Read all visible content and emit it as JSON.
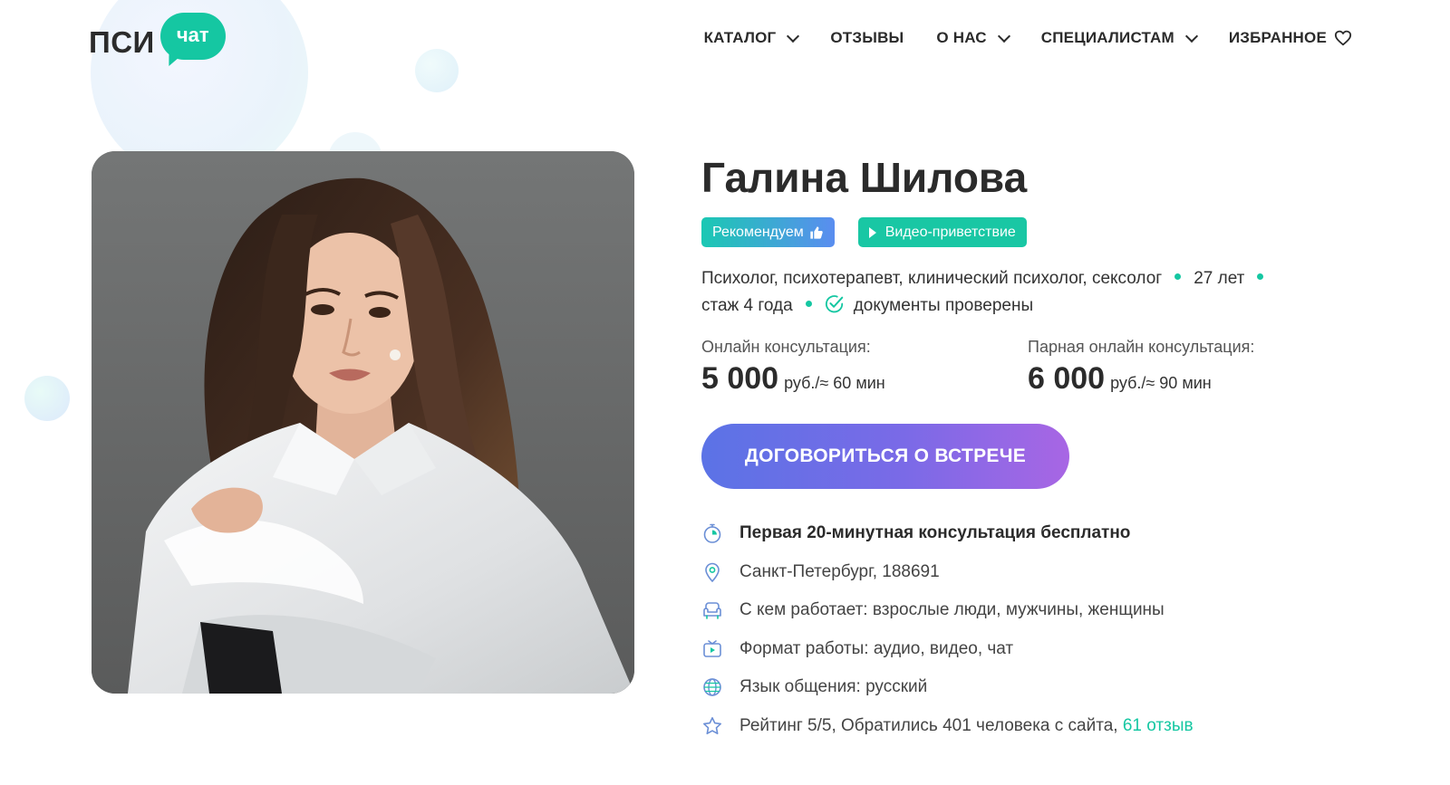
{
  "header": {
    "logo_psi": "ПСИ",
    "logo_chat": "чат",
    "nav": [
      {
        "label": "КАТАЛОГ"
      },
      {
        "label": "ОТЗЫВЫ"
      },
      {
        "label": "О НАС"
      },
      {
        "label": "СПЕЦИАЛИСТАМ"
      },
      {
        "label": "ИЗБРАННОЕ"
      }
    ]
  },
  "profile": {
    "name": "Галина Шилова",
    "badges": {
      "recommended": "Рекомендуем",
      "video": "Видео-приветствие"
    },
    "specialization": "Психолог, психотерапевт, клинический психолог, сексолог",
    "age": "27 лет",
    "experience": "стаж 4 года",
    "documents": "документы проверены"
  },
  "prices": {
    "online": {
      "label": "Онлайн консультация:",
      "value": "5 000",
      "unit": "руб./≈ 60 мин"
    },
    "pair": {
      "label": "Парная онлайн консультация:",
      "value": "6 000",
      "unit": "руб./≈ 90 мин"
    }
  },
  "cta_label": "ДОГОВОРИТЬСЯ О ВСТРЕЧЕ",
  "facts": {
    "free_first": "Первая 20-минутная консультация бесплатно",
    "location": "Санкт-Петербург, 188691",
    "clients": "С кем работает: взрослые люди, мужчины, женщины",
    "format": "Формат работы: аудио, видео, чат",
    "language": "Язык общения: русский",
    "rating": "Рейтинг 5/5, Обратились 401 человека с сайта, ",
    "reviews_link": "61 отзыв"
  },
  "colors": {
    "accent": "#15c7a2",
    "cta_gradient_start": "#5b73e6",
    "cta_gradient_end": "#a866e4",
    "icon_blue": "#6b8fd6"
  }
}
